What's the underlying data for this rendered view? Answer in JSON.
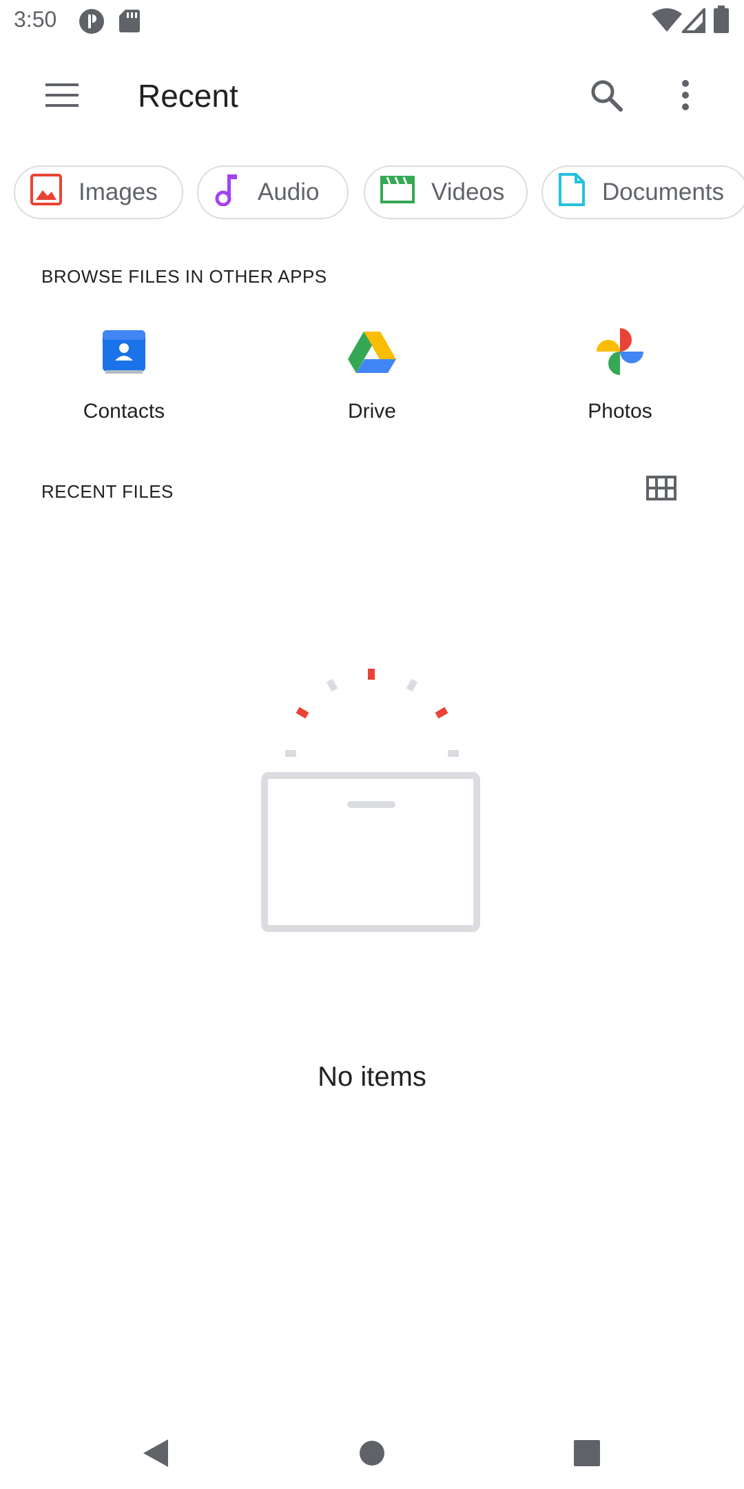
{
  "status_bar": {
    "time": "3:50",
    "icons": [
      "notification-icon",
      "sd-card-icon",
      "wifi-icon",
      "signal-icon",
      "battery-icon"
    ]
  },
  "app_bar": {
    "title": "Recent",
    "menu_icon": "menu-icon",
    "search_icon": "search-icon",
    "more_icon": "more-vert-icon"
  },
  "chips": [
    {
      "label": "Images",
      "icon": "image-icon",
      "color": "#ea4335"
    },
    {
      "label": "Audio",
      "icon": "music-note-icon",
      "color": "#a142f4"
    },
    {
      "label": "Videos",
      "icon": "movie-icon",
      "color": "#34a853"
    },
    {
      "label": "Documents",
      "icon": "document-icon",
      "color": "#24c1e0"
    }
  ],
  "browse_section": {
    "title": "BROWSE FILES IN OTHER APPS",
    "apps": [
      {
        "label": "Contacts",
        "icon": "contacts-icon"
      },
      {
        "label": "Drive",
        "icon": "drive-icon"
      },
      {
        "label": "Photos",
        "icon": "photos-icon"
      }
    ]
  },
  "recent_section": {
    "title": "RECENT FILES",
    "view_icon": "grid-view-icon"
  },
  "empty_state": {
    "message": "No items",
    "icon": "empty-box-icon"
  },
  "nav_bar": {
    "icons": [
      "back-icon",
      "home-icon",
      "recents-icon"
    ]
  }
}
